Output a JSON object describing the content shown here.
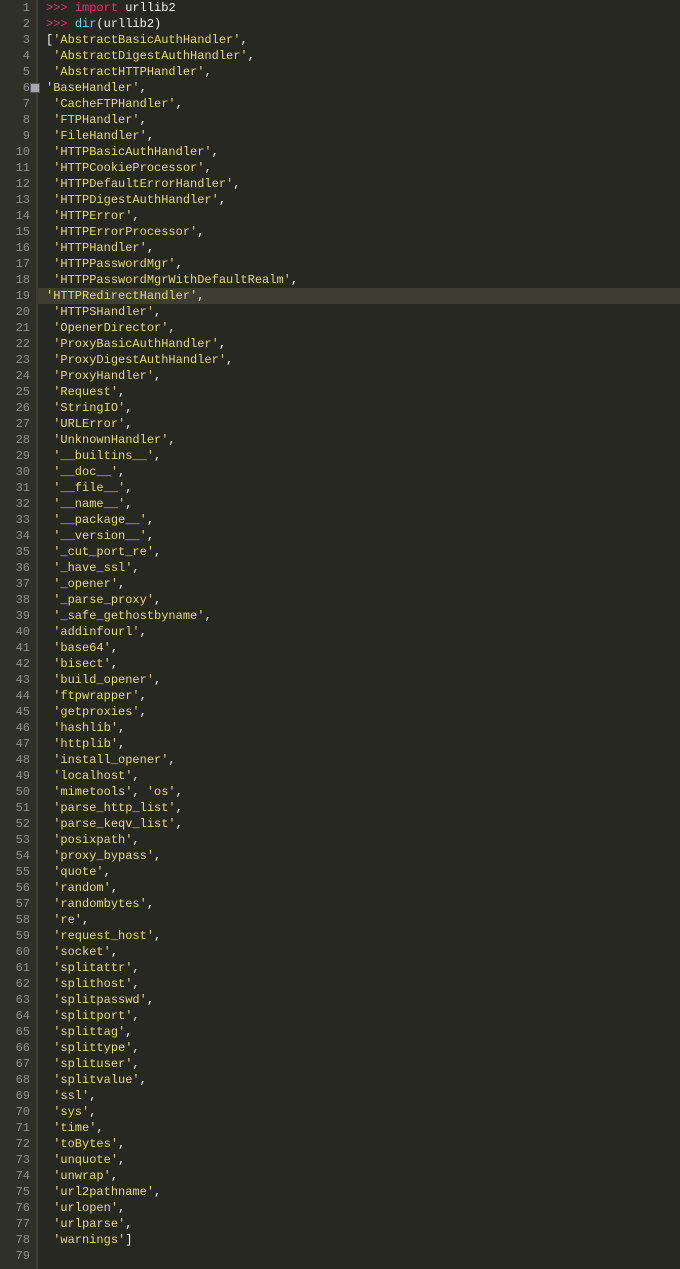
{
  "total_lines": 79,
  "highlight_line": 19,
  "fold_line": 6,
  "lines": [
    {
      "i": 1,
      "indent": 0,
      "tokens": [
        [
          "prompt",
          ">>> "
        ],
        [
          "keyword",
          "import"
        ],
        [
          "ident",
          " urllib2"
        ]
      ]
    },
    {
      "i": 2,
      "indent": 0,
      "tokens": [
        [
          "prompt",
          ">>> "
        ],
        [
          "func",
          "dir"
        ],
        [
          "paren",
          "("
        ],
        [
          "ident",
          "urllib2"
        ],
        [
          "paren",
          ")"
        ]
      ]
    },
    {
      "i": 3,
      "indent": 0,
      "tokens": [
        [
          "bracket",
          "["
        ],
        [
          "str",
          "'AbstractBasicAuthHandler'"
        ],
        [
          "comma",
          ","
        ]
      ]
    },
    {
      "i": 4,
      "indent": 1,
      "tokens": [
        [
          "str",
          "'AbstractDigestAuthHandler'"
        ],
        [
          "comma",
          ","
        ]
      ]
    },
    {
      "i": 5,
      "indent": 1,
      "tokens": [
        [
          "str",
          "'AbstractHTTPHandler'"
        ],
        [
          "comma",
          ","
        ]
      ]
    },
    {
      "i": 6,
      "indent": 0,
      "tokens": [
        [
          "str",
          "'BaseHandler'"
        ],
        [
          "comma",
          ","
        ]
      ]
    },
    {
      "i": 7,
      "indent": 1,
      "tokens": [
        [
          "str",
          "'CacheFTPHandler'"
        ],
        [
          "comma",
          ","
        ]
      ]
    },
    {
      "i": 8,
      "indent": 1,
      "tokens": [
        [
          "str",
          "'FTPHandler'"
        ],
        [
          "comma",
          ","
        ]
      ]
    },
    {
      "i": 9,
      "indent": 1,
      "tokens": [
        [
          "str",
          "'FileHandler'"
        ],
        [
          "comma",
          ","
        ]
      ]
    },
    {
      "i": 10,
      "indent": 1,
      "tokens": [
        [
          "str",
          "'HTTPBasicAuthHandler'"
        ],
        [
          "comma",
          ","
        ]
      ]
    },
    {
      "i": 11,
      "indent": 1,
      "tokens": [
        [
          "str",
          "'HTTPCookieProcessor'"
        ],
        [
          "comma",
          ","
        ]
      ]
    },
    {
      "i": 12,
      "indent": 1,
      "tokens": [
        [
          "str",
          "'HTTPDefaultErrorHandler'"
        ],
        [
          "comma",
          ","
        ]
      ]
    },
    {
      "i": 13,
      "indent": 1,
      "tokens": [
        [
          "str",
          "'HTTPDigestAuthHandler'"
        ],
        [
          "comma",
          ","
        ]
      ]
    },
    {
      "i": 14,
      "indent": 1,
      "tokens": [
        [
          "str",
          "'HTTPError'"
        ],
        [
          "comma",
          ","
        ]
      ]
    },
    {
      "i": 15,
      "indent": 1,
      "tokens": [
        [
          "str",
          "'HTTPErrorProcessor'"
        ],
        [
          "comma",
          ","
        ]
      ]
    },
    {
      "i": 16,
      "indent": 1,
      "tokens": [
        [
          "str",
          "'HTTPHandler'"
        ],
        [
          "comma",
          ","
        ]
      ]
    },
    {
      "i": 17,
      "indent": 1,
      "tokens": [
        [
          "str",
          "'HTTPPasswordMgr'"
        ],
        [
          "comma",
          ","
        ]
      ]
    },
    {
      "i": 18,
      "indent": 1,
      "tokens": [
        [
          "str",
          "'HTTPPasswordMgrWithDefaultRealm'"
        ],
        [
          "comma",
          ","
        ]
      ]
    },
    {
      "i": 19,
      "indent": 0,
      "tokens": [
        [
          "str",
          "'HTTPRedirectHandler'"
        ],
        [
          "comma",
          ","
        ]
      ]
    },
    {
      "i": 20,
      "indent": 1,
      "tokens": [
        [
          "str",
          "'HTTPSHandler'"
        ],
        [
          "comma",
          ","
        ]
      ]
    },
    {
      "i": 21,
      "indent": 1,
      "tokens": [
        [
          "str",
          "'OpenerDirector'"
        ],
        [
          "comma",
          ","
        ]
      ]
    },
    {
      "i": 22,
      "indent": 1,
      "tokens": [
        [
          "str",
          "'ProxyBasicAuthHandler'"
        ],
        [
          "comma",
          ","
        ]
      ]
    },
    {
      "i": 23,
      "indent": 1,
      "tokens": [
        [
          "str",
          "'ProxyDigestAuthHandler'"
        ],
        [
          "comma",
          ","
        ]
      ]
    },
    {
      "i": 24,
      "indent": 1,
      "tokens": [
        [
          "str",
          "'ProxyHandler'"
        ],
        [
          "comma",
          ","
        ]
      ]
    },
    {
      "i": 25,
      "indent": 1,
      "tokens": [
        [
          "str",
          "'Request'"
        ],
        [
          "comma",
          ","
        ]
      ]
    },
    {
      "i": 26,
      "indent": 1,
      "tokens": [
        [
          "str",
          "'StringIO'"
        ],
        [
          "comma",
          ","
        ]
      ]
    },
    {
      "i": 27,
      "indent": 1,
      "tokens": [
        [
          "str",
          "'URLError'"
        ],
        [
          "comma",
          ","
        ]
      ]
    },
    {
      "i": 28,
      "indent": 1,
      "tokens": [
        [
          "str",
          "'UnknownHandler'"
        ],
        [
          "comma",
          ","
        ]
      ]
    },
    {
      "i": 29,
      "indent": 1,
      "tokens": [
        [
          "str",
          "'__builtins__'"
        ],
        [
          "comma",
          ","
        ]
      ]
    },
    {
      "i": 30,
      "indent": 1,
      "tokens": [
        [
          "str",
          "'__doc__'"
        ],
        [
          "comma",
          ","
        ]
      ]
    },
    {
      "i": 31,
      "indent": 1,
      "tokens": [
        [
          "str",
          "'__file__'"
        ],
        [
          "comma",
          ","
        ]
      ]
    },
    {
      "i": 32,
      "indent": 1,
      "tokens": [
        [
          "str",
          "'__name__'"
        ],
        [
          "comma",
          ","
        ]
      ]
    },
    {
      "i": 33,
      "indent": 1,
      "tokens": [
        [
          "str",
          "'__package__'"
        ],
        [
          "comma",
          ","
        ]
      ]
    },
    {
      "i": 34,
      "indent": 1,
      "tokens": [
        [
          "str",
          "'__version__'"
        ],
        [
          "comma",
          ","
        ]
      ]
    },
    {
      "i": 35,
      "indent": 1,
      "tokens": [
        [
          "str",
          "'_cut_port_re'"
        ],
        [
          "comma",
          ","
        ]
      ]
    },
    {
      "i": 36,
      "indent": 1,
      "tokens": [
        [
          "str",
          "'_have_ssl'"
        ],
        [
          "comma",
          ","
        ]
      ]
    },
    {
      "i": 37,
      "indent": 1,
      "tokens": [
        [
          "str",
          "'_opener'"
        ],
        [
          "comma",
          ","
        ]
      ]
    },
    {
      "i": 38,
      "indent": 1,
      "tokens": [
        [
          "str",
          "'_parse_proxy'"
        ],
        [
          "comma",
          ","
        ]
      ]
    },
    {
      "i": 39,
      "indent": 1,
      "tokens": [
        [
          "str",
          "'_safe_gethostbyname'"
        ],
        [
          "comma",
          ","
        ]
      ]
    },
    {
      "i": 40,
      "indent": 1,
      "tokens": [
        [
          "str",
          "'addinfourl'"
        ],
        [
          "comma",
          ","
        ]
      ]
    },
    {
      "i": 41,
      "indent": 1,
      "tokens": [
        [
          "str",
          "'base64'"
        ],
        [
          "comma",
          ","
        ]
      ]
    },
    {
      "i": 42,
      "indent": 1,
      "tokens": [
        [
          "str",
          "'bisect'"
        ],
        [
          "comma",
          ","
        ]
      ]
    },
    {
      "i": 43,
      "indent": 1,
      "tokens": [
        [
          "str",
          "'build_opener'"
        ],
        [
          "comma",
          ","
        ]
      ]
    },
    {
      "i": 44,
      "indent": 1,
      "tokens": [
        [
          "str",
          "'ftpwrapper'"
        ],
        [
          "comma",
          ","
        ]
      ]
    },
    {
      "i": 45,
      "indent": 1,
      "tokens": [
        [
          "str",
          "'getproxies'"
        ],
        [
          "comma",
          ","
        ]
      ]
    },
    {
      "i": 46,
      "indent": 1,
      "tokens": [
        [
          "str",
          "'hashlib'"
        ],
        [
          "comma",
          ","
        ]
      ]
    },
    {
      "i": 47,
      "indent": 1,
      "tokens": [
        [
          "str",
          "'httplib'"
        ],
        [
          "comma",
          ","
        ]
      ]
    },
    {
      "i": 48,
      "indent": 1,
      "tokens": [
        [
          "str",
          "'install_opener'"
        ],
        [
          "comma",
          ","
        ]
      ]
    },
    {
      "i": 49,
      "indent": 1,
      "tokens": [
        [
          "str",
          "'localhost'"
        ],
        [
          "comma",
          ","
        ]
      ]
    },
    {
      "i": 50,
      "indent": 1,
      "tokens": [
        [
          "str",
          "'mimetools'"
        ],
        [
          "comma",
          ", "
        ],
        [
          "str",
          "'os'"
        ],
        [
          "comma",
          ","
        ]
      ]
    },
    {
      "i": 51,
      "indent": 1,
      "tokens": [
        [
          "str",
          "'parse_http_list'"
        ],
        [
          "comma",
          ","
        ]
      ]
    },
    {
      "i": 52,
      "indent": 1,
      "tokens": [
        [
          "str",
          "'parse_keqv_list'"
        ],
        [
          "comma",
          ","
        ]
      ]
    },
    {
      "i": 53,
      "indent": 1,
      "tokens": [
        [
          "str",
          "'posixpath'"
        ],
        [
          "comma",
          ","
        ]
      ]
    },
    {
      "i": 54,
      "indent": 1,
      "tokens": [
        [
          "str",
          "'proxy_bypass'"
        ],
        [
          "comma",
          ","
        ]
      ]
    },
    {
      "i": 55,
      "indent": 1,
      "tokens": [
        [
          "str",
          "'quote'"
        ],
        [
          "comma",
          ","
        ]
      ]
    },
    {
      "i": 56,
      "indent": 1,
      "tokens": [
        [
          "str",
          "'random'"
        ],
        [
          "comma",
          ","
        ]
      ]
    },
    {
      "i": 57,
      "indent": 1,
      "tokens": [
        [
          "str",
          "'randombytes'"
        ],
        [
          "comma",
          ","
        ]
      ]
    },
    {
      "i": 58,
      "indent": 1,
      "tokens": [
        [
          "str",
          "'re'"
        ],
        [
          "comma",
          ","
        ]
      ]
    },
    {
      "i": 59,
      "indent": 1,
      "tokens": [
        [
          "str",
          "'request_host'"
        ],
        [
          "comma",
          ","
        ]
      ]
    },
    {
      "i": 60,
      "indent": 1,
      "tokens": [
        [
          "str",
          "'socket'"
        ],
        [
          "comma",
          ","
        ]
      ]
    },
    {
      "i": 61,
      "indent": 1,
      "tokens": [
        [
          "str",
          "'splitattr'"
        ],
        [
          "comma",
          ","
        ]
      ]
    },
    {
      "i": 62,
      "indent": 1,
      "tokens": [
        [
          "str",
          "'splithost'"
        ],
        [
          "comma",
          ","
        ]
      ]
    },
    {
      "i": 63,
      "indent": 1,
      "tokens": [
        [
          "str",
          "'splitpasswd'"
        ],
        [
          "comma",
          ","
        ]
      ]
    },
    {
      "i": 64,
      "indent": 1,
      "tokens": [
        [
          "str",
          "'splitport'"
        ],
        [
          "comma",
          ","
        ]
      ]
    },
    {
      "i": 65,
      "indent": 1,
      "tokens": [
        [
          "str",
          "'splittag'"
        ],
        [
          "comma",
          ","
        ]
      ]
    },
    {
      "i": 66,
      "indent": 1,
      "tokens": [
        [
          "str",
          "'splittype'"
        ],
        [
          "comma",
          ","
        ]
      ]
    },
    {
      "i": 67,
      "indent": 1,
      "tokens": [
        [
          "str",
          "'splituser'"
        ],
        [
          "comma",
          ","
        ]
      ]
    },
    {
      "i": 68,
      "indent": 1,
      "tokens": [
        [
          "str",
          "'splitvalue'"
        ],
        [
          "comma",
          ","
        ]
      ]
    },
    {
      "i": 69,
      "indent": 1,
      "tokens": [
        [
          "str",
          "'ssl'"
        ],
        [
          "comma",
          ","
        ]
      ]
    },
    {
      "i": 70,
      "indent": 1,
      "tokens": [
        [
          "str",
          "'sys'"
        ],
        [
          "comma",
          ","
        ]
      ]
    },
    {
      "i": 71,
      "indent": 1,
      "tokens": [
        [
          "str",
          "'time'"
        ],
        [
          "comma",
          ","
        ]
      ]
    },
    {
      "i": 72,
      "indent": 1,
      "tokens": [
        [
          "str",
          "'toBytes'"
        ],
        [
          "comma",
          ","
        ]
      ]
    },
    {
      "i": 73,
      "indent": 1,
      "tokens": [
        [
          "str",
          "'unquote'"
        ],
        [
          "comma",
          ","
        ]
      ]
    },
    {
      "i": 74,
      "indent": 1,
      "tokens": [
        [
          "str",
          "'unwrap'"
        ],
        [
          "comma",
          ","
        ]
      ]
    },
    {
      "i": 75,
      "indent": 1,
      "tokens": [
        [
          "str",
          "'url2pathname'"
        ],
        [
          "comma",
          ","
        ]
      ]
    },
    {
      "i": 76,
      "indent": 1,
      "tokens": [
        [
          "str",
          "'urlopen'"
        ],
        [
          "comma",
          ","
        ]
      ]
    },
    {
      "i": 77,
      "indent": 1,
      "tokens": [
        [
          "str",
          "'urlparse'"
        ],
        [
          "comma",
          ","
        ]
      ]
    },
    {
      "i": 78,
      "indent": 1,
      "tokens": [
        [
          "str",
          "'warnings'"
        ],
        [
          "bracket",
          "]"
        ]
      ]
    },
    {
      "i": 79,
      "indent": 0,
      "tokens": []
    }
  ]
}
